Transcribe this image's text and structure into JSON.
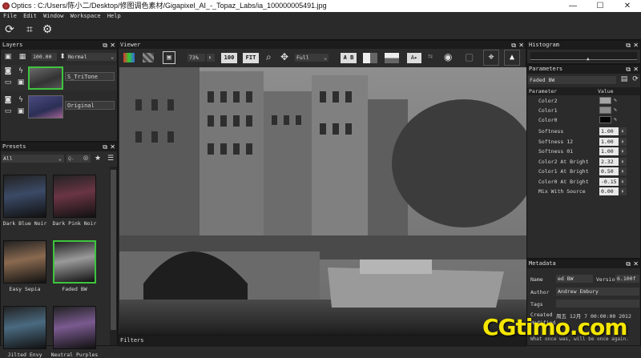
{
  "window": {
    "title": "Optics : C:/Users/陈小二/Desktop/修图调色素材/Gigapixel_AI_-_Topaz_Labs/ia_100000005491.jpg",
    "minimize": "—",
    "maximize": "☐",
    "close": "✕"
  },
  "menu": [
    "File",
    "Edit",
    "Window",
    "Workspace",
    "Help"
  ],
  "toolbar": {
    "refresh_icon": "refresh-icon",
    "crop_icon": "crop-icon",
    "export_icon": "export-icon"
  },
  "layers": {
    "title": "Layers",
    "opacity": "100.00",
    "blend_mode": "Normal",
    "items": [
      {
        "name": "S_TriTone",
        "selected": true
      },
      {
        "name": "Original",
        "selected": false
      }
    ]
  },
  "presets": {
    "title": "Presets",
    "category": "All",
    "search_placeholder": "Q-",
    "items": [
      {
        "name": "Dark Blue Noir",
        "tint": "#3b4a66"
      },
      {
        "name": "Dark Pink Noir",
        "tint": "#6a3545"
      },
      {
        "name": "Easy Sepia",
        "tint": "#8a6a50"
      },
      {
        "name": "Faded BW",
        "tint": "#9a9a9a",
        "selected": true
      },
      {
        "name": "Jilted Envy",
        "tint": "#4a6a80"
      },
      {
        "name": "Neutral Purples",
        "tint": "#7a5a90"
      }
    ]
  },
  "viewer": {
    "title": "Viewer",
    "zoom": "73%",
    "zoom_button": "100",
    "fit_button": "FIT",
    "view_mode": "Full",
    "ab_label": "A B"
  },
  "filters": {
    "title": "Filters"
  },
  "histogram": {
    "title": "Histogram"
  },
  "parameters": {
    "title": "Parameters",
    "preset_name": "Faded BW",
    "col_parameter": "Parameter",
    "col_value": "Value",
    "colors": [
      {
        "label": "Color2",
        "color": "#a6a6a6"
      },
      {
        "label": "Color1",
        "color": "#8c8c8c"
      },
      {
        "label": "Color0",
        "color": "#050505"
      }
    ],
    "values": [
      {
        "label": "Softness",
        "value": "1.00"
      },
      {
        "label": "Softness 12",
        "value": "1.00"
      },
      {
        "label": "Softness 01",
        "value": "1.00"
      },
      {
        "label": "Color2 At Bright",
        "value": "2.32"
      },
      {
        "label": "Color1 At Bright",
        "value": "0.50"
      },
      {
        "label": "Color0 At Bright",
        "value": "-0.15"
      },
      {
        "label": "Mix With Source",
        "value": "0.00"
      }
    ]
  },
  "metadata": {
    "title": "Metadata",
    "name_label": "Name",
    "name_value": "ed BW",
    "version_label": "Version",
    "version_value": "6.100f",
    "author_label": "Author",
    "author_value": "Andrew Embury",
    "tags_label": "Tags",
    "created_label": "Created",
    "created_value": "周五 12月 7 00:00:00 2012",
    "modified_label": "Modified",
    "footer": "What once was, will be once again."
  },
  "watermark": "CGtimo.com"
}
